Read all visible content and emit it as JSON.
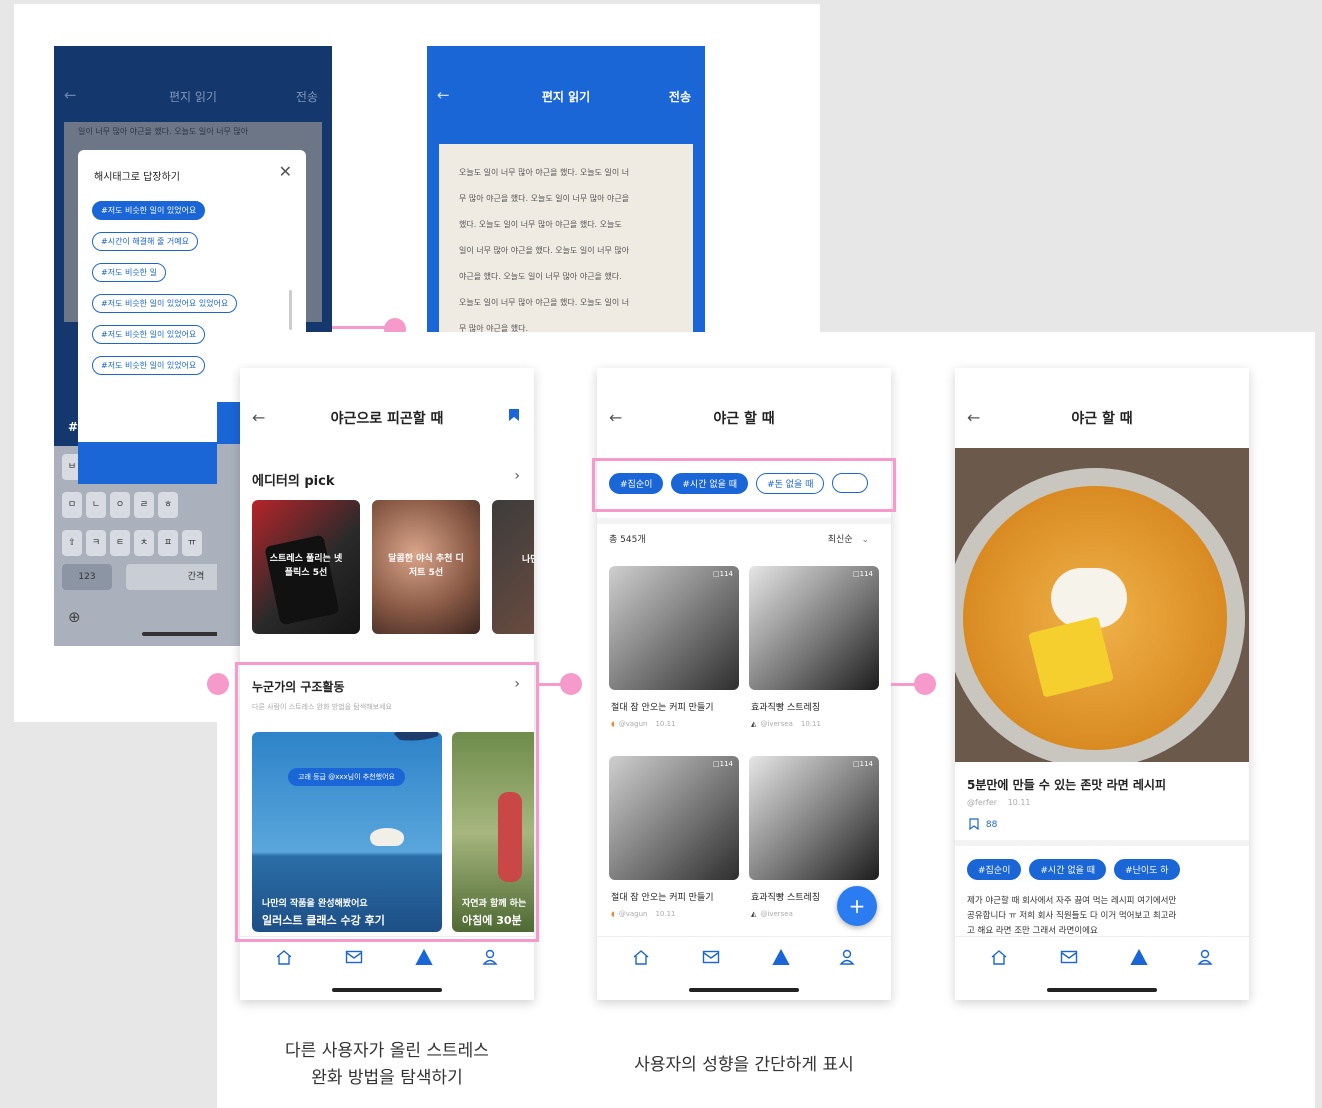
{
  "top_left_phone": {
    "header_title": "편지 읽기",
    "header_send": "전송",
    "letter_line": "일이 너무 많아 야근을 했다. 오늘도 일이 너무 많아",
    "modal_title": "해시태그로 답장하기",
    "chips": [
      "#저도 비슷한 일이 있었어요",
      "#시간이 해결해 줄 거예요",
      "#저도 비슷한 일",
      "#저도 비슷한 일이 있었어요 있었어요",
      "#저도 비슷한 일이 있었어요",
      "#저도 비슷한 일이 있었어요"
    ],
    "confirm": "확인",
    "keyboard_rows": [
      [
        "ㅂ",
        "ㅈ",
        "ㄷ",
        "ㄱ",
        "ㅅ",
        "ㅛ"
      ],
      [
        "ㅁ",
        "ㄴ",
        "ㅇ",
        "ㄹ",
        "ㅎ"
      ],
      [
        "⇧",
        "ㅋ",
        "ㅌ",
        "ㅊ",
        "ㅍ",
        "ㅠ"
      ]
    ],
    "key_123": "123",
    "key_space": "간격",
    "hash_key": "#"
  },
  "top_right_phone": {
    "header_title": "편지 읽기",
    "header_send": "전송",
    "letter_lines": [
      "오늘도 일이 너무 많아 야근을 했다. 오늘도 일이 너",
      "무 많아 야근을 했다. 오늘도 일이 너무 많아 야근을",
      "했다. 오늘도 일이 너무 많아 야근을 했다. 오늘도",
      "일이 너무 많아 야근을 했다. 오늘도 일이 너무 많아",
      "야근을 했다. 오늘도 일이 너무 많아 야근을 했다.",
      "오늘도 일이 너무 많아 야근을 했다. 오늘도 일이 너",
      "무 많아 야근을 했다."
    ]
  },
  "phone1": {
    "title": "야근으로 피곤할 때",
    "editor_pick": "에디터의 pick",
    "pick_cards": [
      "스트레스 풀리는 넷플릭스 5선",
      "달콤한 야식 추천 디저트 5선",
      "나만"
    ],
    "someone_title": "누군가의 구조활동",
    "someone_sub": "다른 사람이 스트레스 완화 방법을 탐색해보세요",
    "badge": "고래 등급 @xxx님이 추천했어요",
    "card1_line1": "나만의 작품을 완성해봤어요",
    "card1_line2": "일러스트 클래스 수강 후기",
    "card2_line1": "자연과 함께 하는",
    "card2_line2": "아침에 30분"
  },
  "phone2": {
    "title": "야근 할 때",
    "chips": [
      "#집순이",
      "#시간 없을 때",
      "#돈 없을 때"
    ],
    "count": "총 545개",
    "sort": "최신순",
    "items": [
      {
        "title": "절대 잠 안오는 커피 만들기",
        "user": "@vagun",
        "date": "10.11",
        "badge": "114"
      },
      {
        "title": "효과직빵 스트레칭",
        "user": "@iversea",
        "date": "10.11",
        "badge": "114"
      },
      {
        "title": "절대 잠 안오는 커피 만들기",
        "user": "@vagun",
        "date": "10.11",
        "badge": "114"
      },
      {
        "title": "효과직빵 스트레칭",
        "user": "@iversea",
        "date": "",
        "badge": "114"
      }
    ],
    "fab": "+"
  },
  "phone3": {
    "title": "야근 할 때",
    "recipe_title": "5분만에 만들 수 있는 존맛 라면 레시피",
    "author": "@ferfer",
    "date": "10.11",
    "bookmark_count": "88",
    "chips": [
      "#집순이",
      "#시간 없을 때",
      "#난이도 하"
    ],
    "desc_line1": "제가 야근할 때 회사에서 자주 끓여 먹는 레시피 여기에서만",
    "desc_line2": "공유합니다 ㅠ 저희 회사 직원들도 다 이거 먹어보고 최고라",
    "desc_line3": "고 해요 라면 조만 그래서 라면이에요"
  },
  "captions": {
    "left_line1": "다른 사용자가 올린 스트레스",
    "left_line2": "완화 방법을 탐색하기",
    "middle": "사용자의 성향을 간단하게 표시"
  },
  "colors": {
    "primary": "#1a66d6",
    "navy": "#14376e",
    "highlight": "#f59acb"
  }
}
